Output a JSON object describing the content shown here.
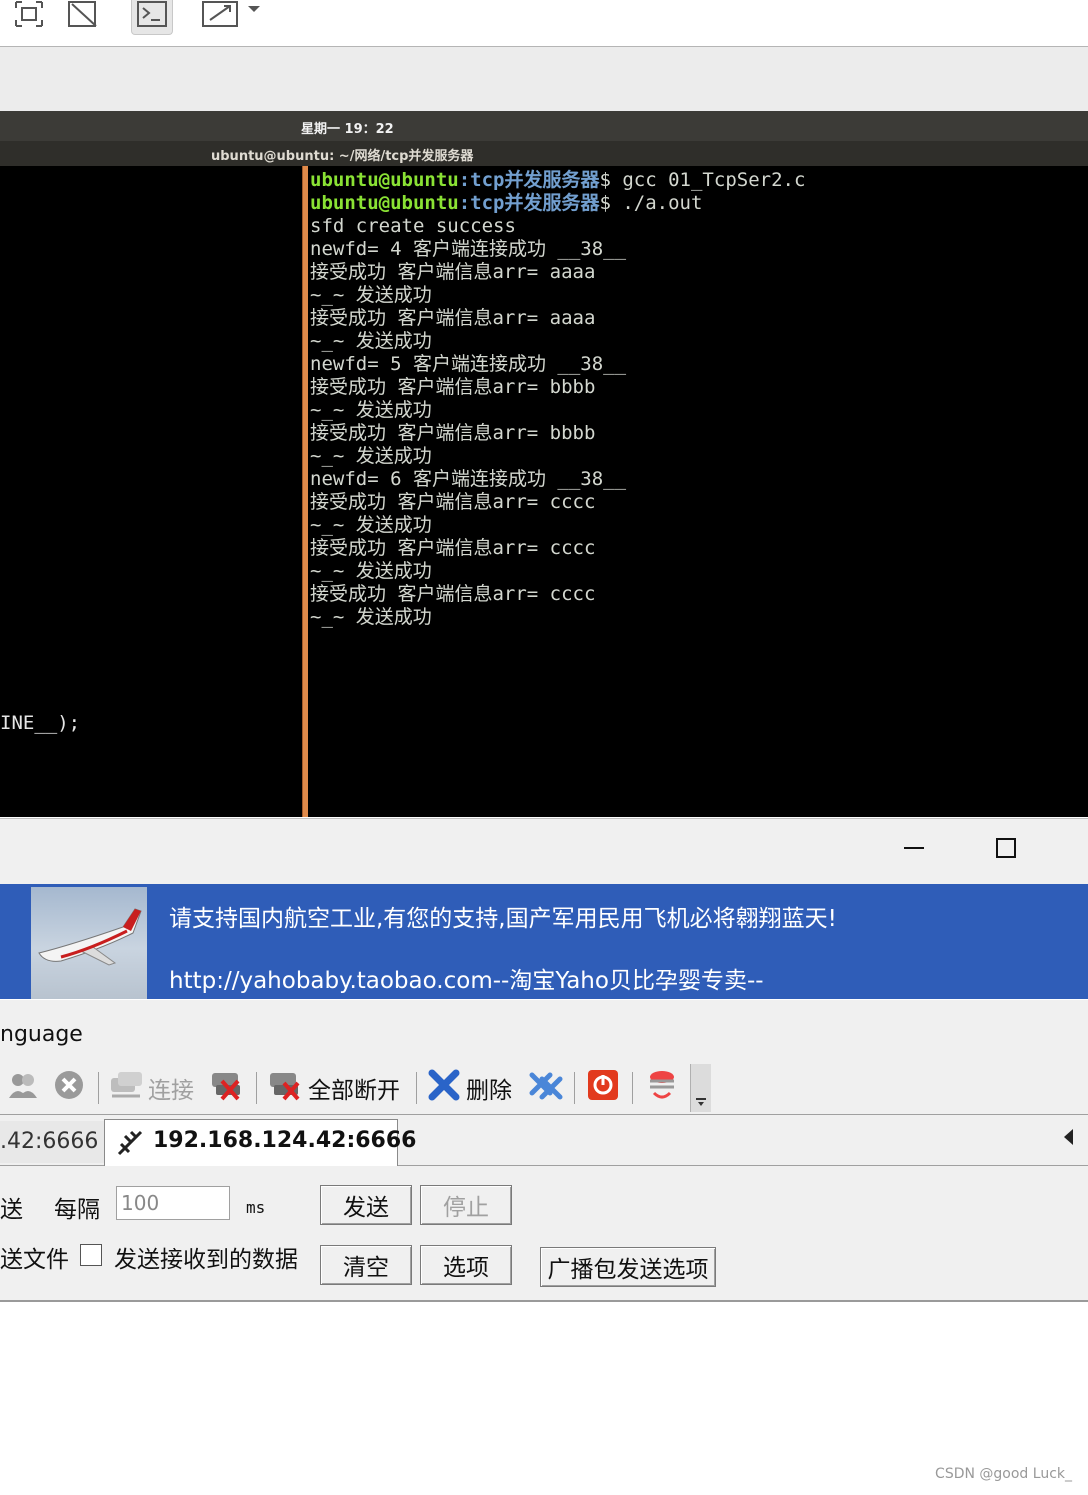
{
  "ubuntu": {
    "clock": "星期一 19：22",
    "window_title": "ubuntu@ubuntu: ~/网络/tcp并发服务器"
  },
  "left_terminal": {
    "visible_code": "INE__);"
  },
  "right_terminal": {
    "prompt_user": "ubuntu@ubuntu",
    "prompt_path": ":tcp并发服务器",
    "commands": [
      "$ gcc 01_TcpSer2.c",
      "$ ./a.out"
    ],
    "output": [
      "sfd create success",
      "newfd= 4 客户端连接成功 __38__",
      "接受成功 客户端信息arr= aaaa",
      "~_~ 发送成功",
      "接受成功 客户端信息arr= aaaa",
      "~_~ 发送成功",
      "newfd= 5 客户端连接成功 __38__",
      "接受成功 客户端信息arr= bbbb",
      "~_~ 发送成功",
      "接受成功 客户端信息arr= bbbb",
      "~_~ 发送成功",
      "newfd= 6 客户端连接成功 __38__",
      "接受成功 客户端信息arr= cccc",
      "~_~ 发送成功",
      "接受成功 客户端信息arr= cccc",
      "~_~ 发送成功",
      "接受成功 客户端信息arr= cccc",
      "~_~ 发送成功"
    ]
  },
  "banner": {
    "line1": "请支持国内航空工业,有您的支持,国产军用民用飞机必将翱翔蓝天!",
    "line2": "http://yahobaby.taobao.com--淘宝Yaho贝比孕婴专卖--"
  },
  "menu": {
    "language": "nguage"
  },
  "toolbar": {
    "connect": "连接",
    "disconnect_all": "全部断开",
    "delete": "删除"
  },
  "tabs": {
    "tab1": ".42:6666",
    "tab2": "192.168.124.42:6666"
  },
  "send_settings": {
    "send_label": "送",
    "interval_label": "每隔",
    "interval_value": "100",
    "interval_unit": "ms",
    "send_button": "发送",
    "stop_button": "停止",
    "send_file_label": "送文件",
    "send_received_label": "发送接收到的数据",
    "clear_button": "清空",
    "options_button": "选项",
    "broadcast_button": "广播包发送选项"
  },
  "watermark": "CSDN @good Luck_",
  "colors": {
    "prompt_user": "#8ae234",
    "prompt_path": "#729fcf",
    "banner_bg": "#2f5db8",
    "terminal_divider": "#e08a4a"
  }
}
